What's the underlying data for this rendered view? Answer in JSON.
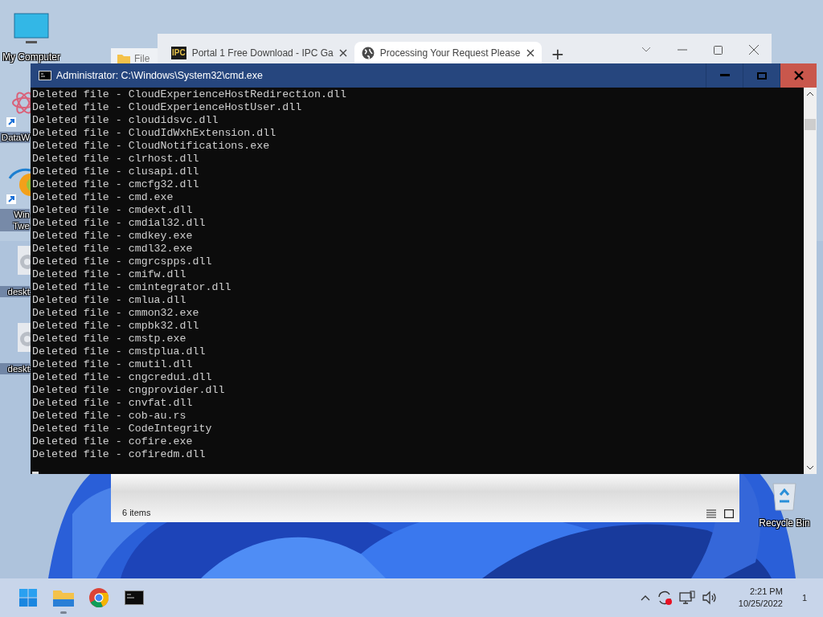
{
  "desktop_icons": [
    {
      "kind": "computer",
      "label": "My Computer",
      "shortcut": false
    },
    {
      "kind": "app-red",
      "label": "DataW",
      "shortcut": true
    },
    {
      "kind": "app-orb",
      "label": "Win Twe",
      "shortcut": true
    },
    {
      "kind": "file-gear",
      "label": "deskt",
      "shortcut": false
    },
    {
      "kind": "file-gear",
      "label": "deskt",
      "shortcut": false
    }
  ],
  "explorer": {
    "tab_title": "File",
    "status": "6 items"
  },
  "browser": {
    "tabs": [
      {
        "kind": "ipc",
        "favicon_text": "IPC",
        "title": "Portal 1 Free Download - IPC Ga",
        "selected": false
      },
      {
        "kind": "globe",
        "title": "Processing Your Request Please",
        "selected": true
      }
    ],
    "new_tab": "+"
  },
  "cmd": {
    "title": "Administrator:  C:\\Windows\\System32\\cmd.exe",
    "lines": [
      "Deleted file - CloudExperienceHostRedirection.dll",
      "Deleted file - CloudExperienceHostUser.dll",
      "Deleted file - cloudidsvc.dll",
      "Deleted file - CloudIdWxhExtension.dll",
      "Deleted file - CloudNotifications.exe",
      "Deleted file - clrhost.dll",
      "Deleted file - clusapi.dll",
      "Deleted file - cmcfg32.dll",
      "Deleted file - cmd.exe",
      "Deleted file - cmdext.dll",
      "Deleted file - cmdial32.dll",
      "Deleted file - cmdkey.exe",
      "Deleted file - cmdl32.exe",
      "Deleted file - cmgrcspps.dll",
      "Deleted file - cmifw.dll",
      "Deleted file - cmintegrator.dll",
      "Deleted file - cmlua.dll",
      "Deleted file - cmmon32.exe",
      "Deleted file - cmpbk32.dll",
      "Deleted file - cmstp.exe",
      "Deleted file - cmstplua.dll",
      "Deleted file - cmutil.dll",
      "Deleted file - cngcredui.dll",
      "Deleted file - cngprovider.dll",
      "Deleted file - cnvfat.dll",
      "Deleted file - cob-au.rs",
      "Deleted file - CodeIntegrity",
      "Deleted file - cofire.exe",
      "Deleted file - cofiredm.dll"
    ]
  },
  "recycle_bin": {
    "label": "Recycle Bin"
  },
  "taskbar": {
    "apps": [
      {
        "kind": "start",
        "running": false
      },
      {
        "kind": "explorer",
        "running": true
      },
      {
        "kind": "chrome",
        "running": false
      },
      {
        "kind": "terminal",
        "running": false
      }
    ],
    "time": "2:21 PM",
    "date": "10/25/2022",
    "notifications": "1"
  }
}
